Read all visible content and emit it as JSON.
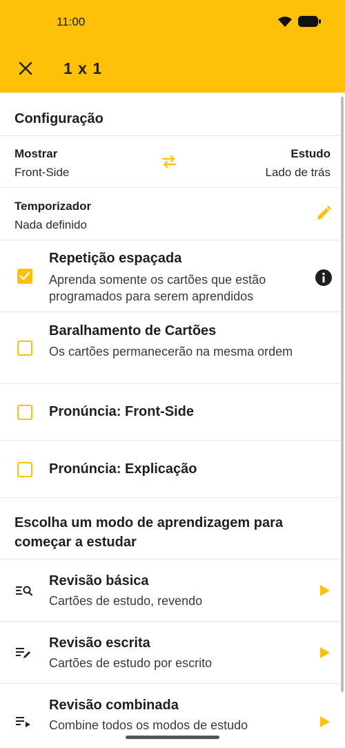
{
  "status_bar": {
    "time": "11:00"
  },
  "app_bar": {
    "title": "1 x 1"
  },
  "config": {
    "title": "Configuração",
    "show_label": "Mostrar",
    "show_value": "Front-Side",
    "study_label": "Estudo",
    "study_value": "Lado de trás",
    "timer_label": "Temporizador",
    "timer_value": "Nada definido"
  },
  "options": [
    {
      "title": "Repetição espaçada",
      "subtitle": "Aprenda somente os cartões que estão programados para serem aprendidos",
      "checked": true
    },
    {
      "title": "Baralhamento de Cartões",
      "subtitle": "Os cartões permanecerão na mesma ordem",
      "checked": false
    },
    {
      "title": "Pronúncia: Front-Side",
      "checked": false
    },
    {
      "title": "Pronúncia: Explicação",
      "checked": false
    }
  ],
  "modes_section": {
    "title": "Escolha um modo de aprendizagem para começar a estudar"
  },
  "modes": [
    {
      "title": "Revisão básica",
      "subtitle": "Cartões de estudo, revendo",
      "icon": "list-search-icon"
    },
    {
      "title": "Revisão escrita",
      "subtitle": "Cartões de estudo por escrito",
      "icon": "list-edit-icon"
    },
    {
      "title": "Revisão combinada",
      "subtitle": "Combine todos os modos de estudo",
      "icon": "list-play-icon"
    }
  ],
  "colors": {
    "accent": "#FFC107",
    "text": "#1f1f1f",
    "divider": "#e6e6e6"
  }
}
